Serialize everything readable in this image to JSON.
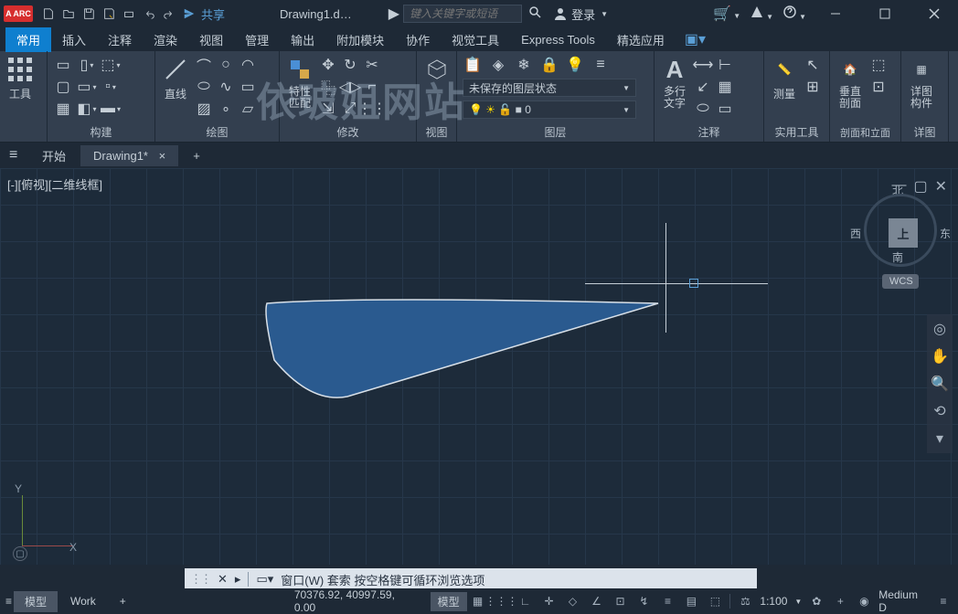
{
  "app": {
    "badge": "A ARC",
    "title": "Drawing1.d…"
  },
  "search": {
    "placeholder": "键入关键字或短语"
  },
  "login": {
    "label": "登录"
  },
  "share": {
    "label": "共享"
  },
  "ribbon": {
    "tabs": [
      "常用",
      "插入",
      "注释",
      "渲染",
      "视图",
      "管理",
      "输出",
      "附加模块",
      "协作",
      "视觉工具",
      "Express Tools",
      "精选应用"
    ],
    "active": 0,
    "panels": {
      "tools": "工具",
      "construct": "构建",
      "draw": "绘图",
      "line": "直线",
      "modify": "修改",
      "props": "特性\n匹配",
      "view": "视图",
      "layer": "图层",
      "layer_state": "未保存的图层状态",
      "layer_current": "0",
      "text": "多行\n文字",
      "annotate": "注释",
      "measure": "测量",
      "utility": "实用工具",
      "section": "垂直\n剖面",
      "section_panel": "剖面和立面",
      "detail": "详图\n构件",
      "detail_panel": "详图"
    }
  },
  "docs": {
    "start": "开始",
    "active": "Drawing1*"
  },
  "viewport": {
    "label": "[-][俯视][二维线框]"
  },
  "viewcube": {
    "top": "上",
    "n": "北",
    "s": "南",
    "e": "东",
    "w": "西",
    "wcs": "WCS"
  },
  "cmd": {
    "prompt": "窗口(W)  套索    按空格键可循环浏览选项"
  },
  "status": {
    "model": "模型",
    "work": "Work",
    "coords": "70376.92, 40997.59, 0.00",
    "model2": "模型",
    "scale": "1:100",
    "style": "Medium D"
  },
  "watermark": "依玻姐网站"
}
